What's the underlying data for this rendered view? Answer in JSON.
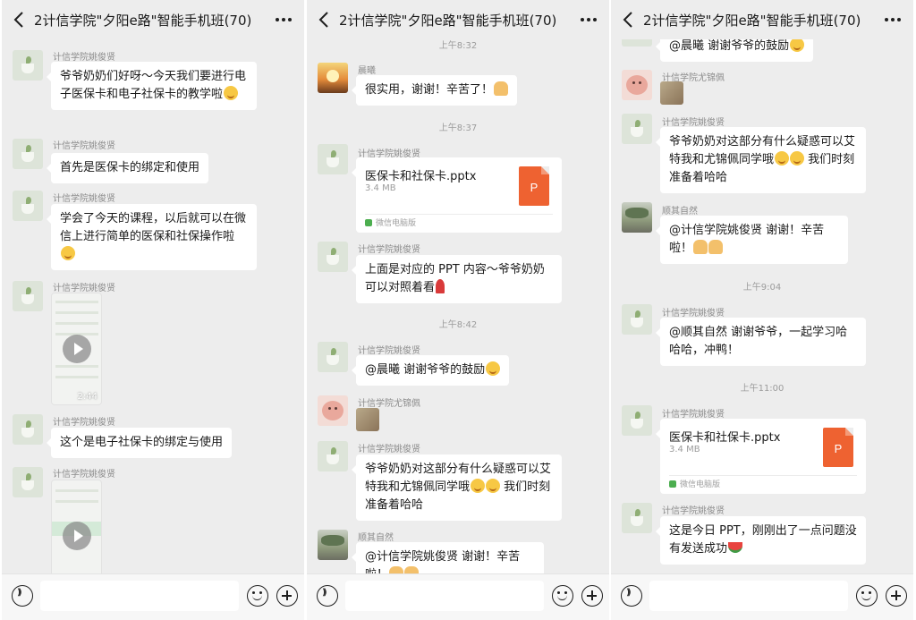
{
  "colors": {
    "chat_background": "#ededed",
    "bubble": "#ffffff",
    "ppt_icon": "#ee6231",
    "wechat_green": "#4cae4f"
  },
  "screens": [
    {
      "title": "2计信学院\"夕阳e路\"智能手机班(70)",
      "messages": [
        {
          "sender": "计信学院姚俊贤",
          "text": "爷爷奶奶们好呀～今天我们要进行电子医保卡和电子社保卡的教学啦",
          "emoji": "grin-emoji"
        },
        {
          "sender": "计信学院姚俊贤",
          "text": "首先是医保卡的绑定和使用"
        },
        {
          "sender": "计信学院姚俊贤",
          "text": "学会了今天的课程，以后就可以在微信上进行简单的医保和社保操作啦",
          "emoji": "shush-emoji"
        },
        {
          "sender": "计信学院姚俊贤",
          "video_duration": "2:44"
        },
        {
          "sender": "计信学院姚俊贤",
          "text": "这个是电子社保卡的绑定与使用"
        },
        {
          "sender": "计信学院姚俊贤"
        }
      ]
    },
    {
      "title": "2计信学院\"夕阳e路\"智能手机班(70)",
      "messages": [
        {
          "time": "上午8:32"
        },
        {
          "sender": "晨曦",
          "text": "很实用，谢谢！辛苦了！",
          "emoji": "pray-emoji"
        },
        {
          "time": "上午8:37"
        },
        {
          "sender": "计信学院姚俊贤",
          "file_name": "医保卡和社保卡.pptx",
          "file_size": "3.4 MB",
          "file_source": "微信电脑版",
          "file_icon": "P"
        },
        {
          "sender": "计信学院姚俊贤",
          "text": "上面是对应的 PPT 内容～爷爷奶奶可以对照着看",
          "emoji": "rose-emoji"
        },
        {
          "time": "上午8:42"
        },
        {
          "sender": "计信学院姚俊贤",
          "text": "@晨曦  谢谢爷爷的鼓励",
          "emoji": "smile-emoji"
        },
        {
          "sender": "计信学院尤锦佩"
        },
        {
          "sender": "计信学院姚俊贤",
          "text": "爷爷奶奶对这部分有什么疑惑可以艾特我和尤锦佩同学哦",
          "text_tail": " 我们时刻准备着哈哈"
        },
        {
          "sender": "顺其自然",
          "text": "@计信学院姚俊贤  谢谢！辛苦啦！"
        }
      ]
    },
    {
      "title": "2计信学院\"夕阳e路\"智能手机班(70)",
      "messages": [
        {
          "text": "@晨曦  谢谢爷爷的鼓励",
          "emoji": "smile-emoji"
        },
        {
          "sender": "计信学院尤锦佩"
        },
        {
          "sender": "计信学院姚俊贤",
          "text": "爷爷奶奶对这部分有什么疑惑可以艾特我和尤锦佩同学哦",
          "text_tail": " 我们时刻准备着哈哈"
        },
        {
          "sender": "顺其自然",
          "text": "@计信学院姚俊贤  谢谢！辛苦啦！"
        },
        {
          "time": "上午9:04"
        },
        {
          "sender": "计信学院姚俊贤",
          "text": "@顺其自然  谢谢爷爷，一起学习哈哈哈，冲鸭！"
        },
        {
          "time": "上午11:00"
        },
        {
          "sender": "计信学院姚俊贤",
          "file_name": "医保卡和社保卡.pptx",
          "file_size": "3.4 MB",
          "file_source": "微信电脑版",
          "file_icon": "P"
        },
        {
          "sender": "计信学院姚俊贤",
          "text": "这是今日 PPT，刚刚出了一点问题没有发送成功",
          "emoji": "watermelon-emoji"
        }
      ]
    }
  ]
}
